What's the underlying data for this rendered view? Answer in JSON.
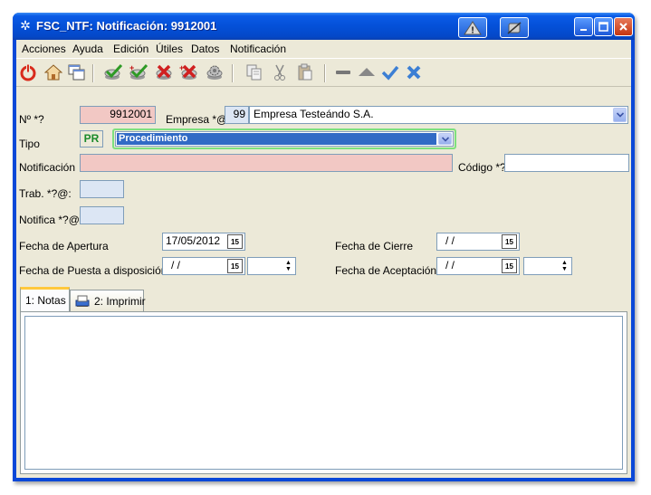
{
  "window": {
    "title": "FSC_NTF: Notificación: 9912001"
  },
  "menu": [
    {
      "label": "Acciones"
    },
    {
      "label": "Ayuda"
    },
    {
      "label": "Edición"
    },
    {
      "label": "Útiles"
    },
    {
      "label": "Datos"
    },
    {
      "label": "Notificación"
    }
  ],
  "toolbar": {
    "icons": [
      "power-icon",
      "home-icon",
      "windows-icon",
      "check-icon",
      "check-plus-icon",
      "cancel-icon",
      "cancel-plus-icon",
      "gear-icon",
      "copy-icon",
      "cut-icon",
      "paste-icon",
      "minus-icon",
      "up-icon",
      "ok-icon",
      "delete-icon"
    ]
  },
  "form": {
    "num_label": "Nº *?",
    "num_value": "9912001",
    "empresa_label": "Empresa *@:",
    "empresa_code": "99",
    "empresa_name": "Empresa Testeándo S.A.",
    "tipo_label": "Tipo",
    "tipo_code": "PR",
    "tipo_value": "Procedimiento",
    "notificacion_label": "Notificación",
    "notificacion_value": "",
    "codigo_label": "Código *?",
    "codigo_value": "",
    "trab_label": "Trab.  *?@:",
    "trab_value": "",
    "notifica_label": "Notifica *?@:",
    "notifica_value": "",
    "fecha_apertura_label": "Fecha de  Apertura",
    "fecha_apertura_value": "17/05/2012",
    "fecha_cierre_label": "Fecha de Cierre",
    "fecha_cierre_value": "/ /",
    "fecha_puesta_label": "Fecha de Puesta a disposición",
    "fecha_puesta_value": "/ /",
    "fecha_aceptacion_label": "Fecha de Aceptación",
    "fecha_aceptacion_value": "/ /",
    "cal_icon_text": "15"
  },
  "tabs": [
    {
      "label": "1: Notas"
    },
    {
      "label": "2: Imprimir"
    }
  ],
  "colors": {
    "titlebar": "#0450d8",
    "client_bg": "#ece9d8",
    "required_pink": "#f2c8c4",
    "lookup_blue": "#dce6f4",
    "selected_blue": "#316ac5"
  }
}
